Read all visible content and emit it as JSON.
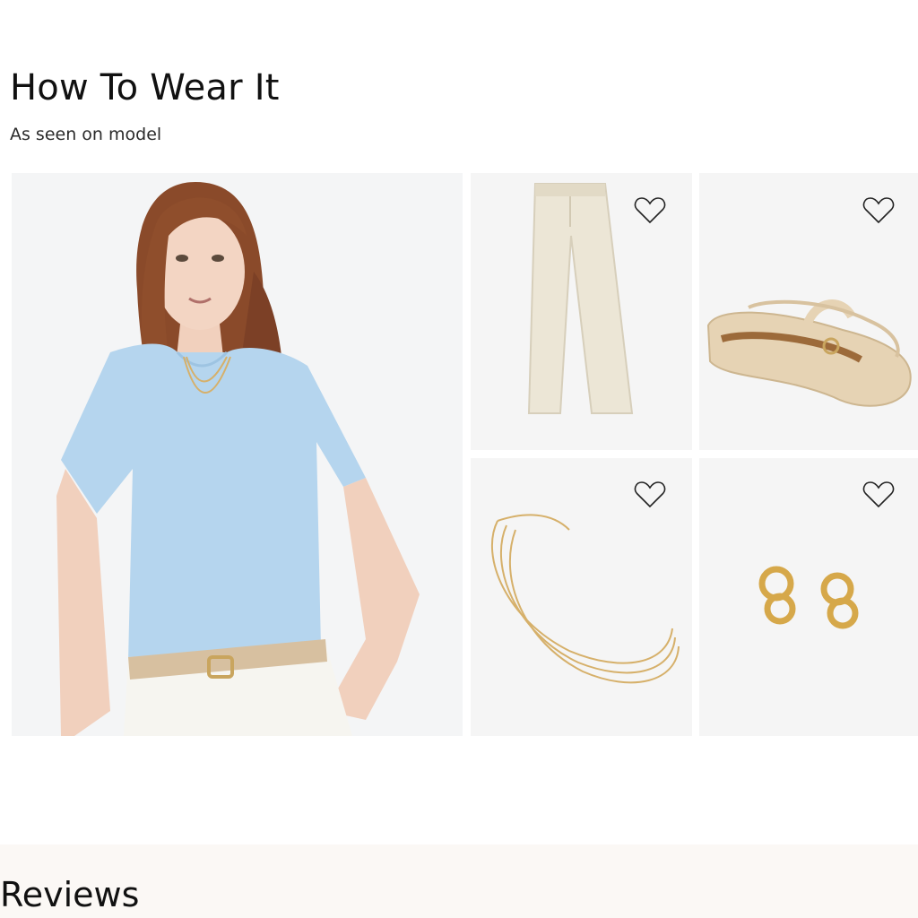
{
  "how_to_wear": {
    "title": "How To Wear It",
    "subtitle": "As seen on model"
  },
  "products": [
    {
      "name": "pants",
      "icon": "heart-icon"
    },
    {
      "name": "flats",
      "icon": "heart-icon"
    },
    {
      "name": "necklace",
      "icon": "heart-icon"
    },
    {
      "name": "earrings",
      "icon": "heart-icon"
    }
  ],
  "reviews": {
    "title": "Reviews"
  },
  "colors": {
    "tile_bg": "#f5f5f5",
    "top_blue": "#b5d5ee",
    "hair": "#8a4a2a",
    "cream": "#ece6d6",
    "gold": "#d6b06a"
  }
}
